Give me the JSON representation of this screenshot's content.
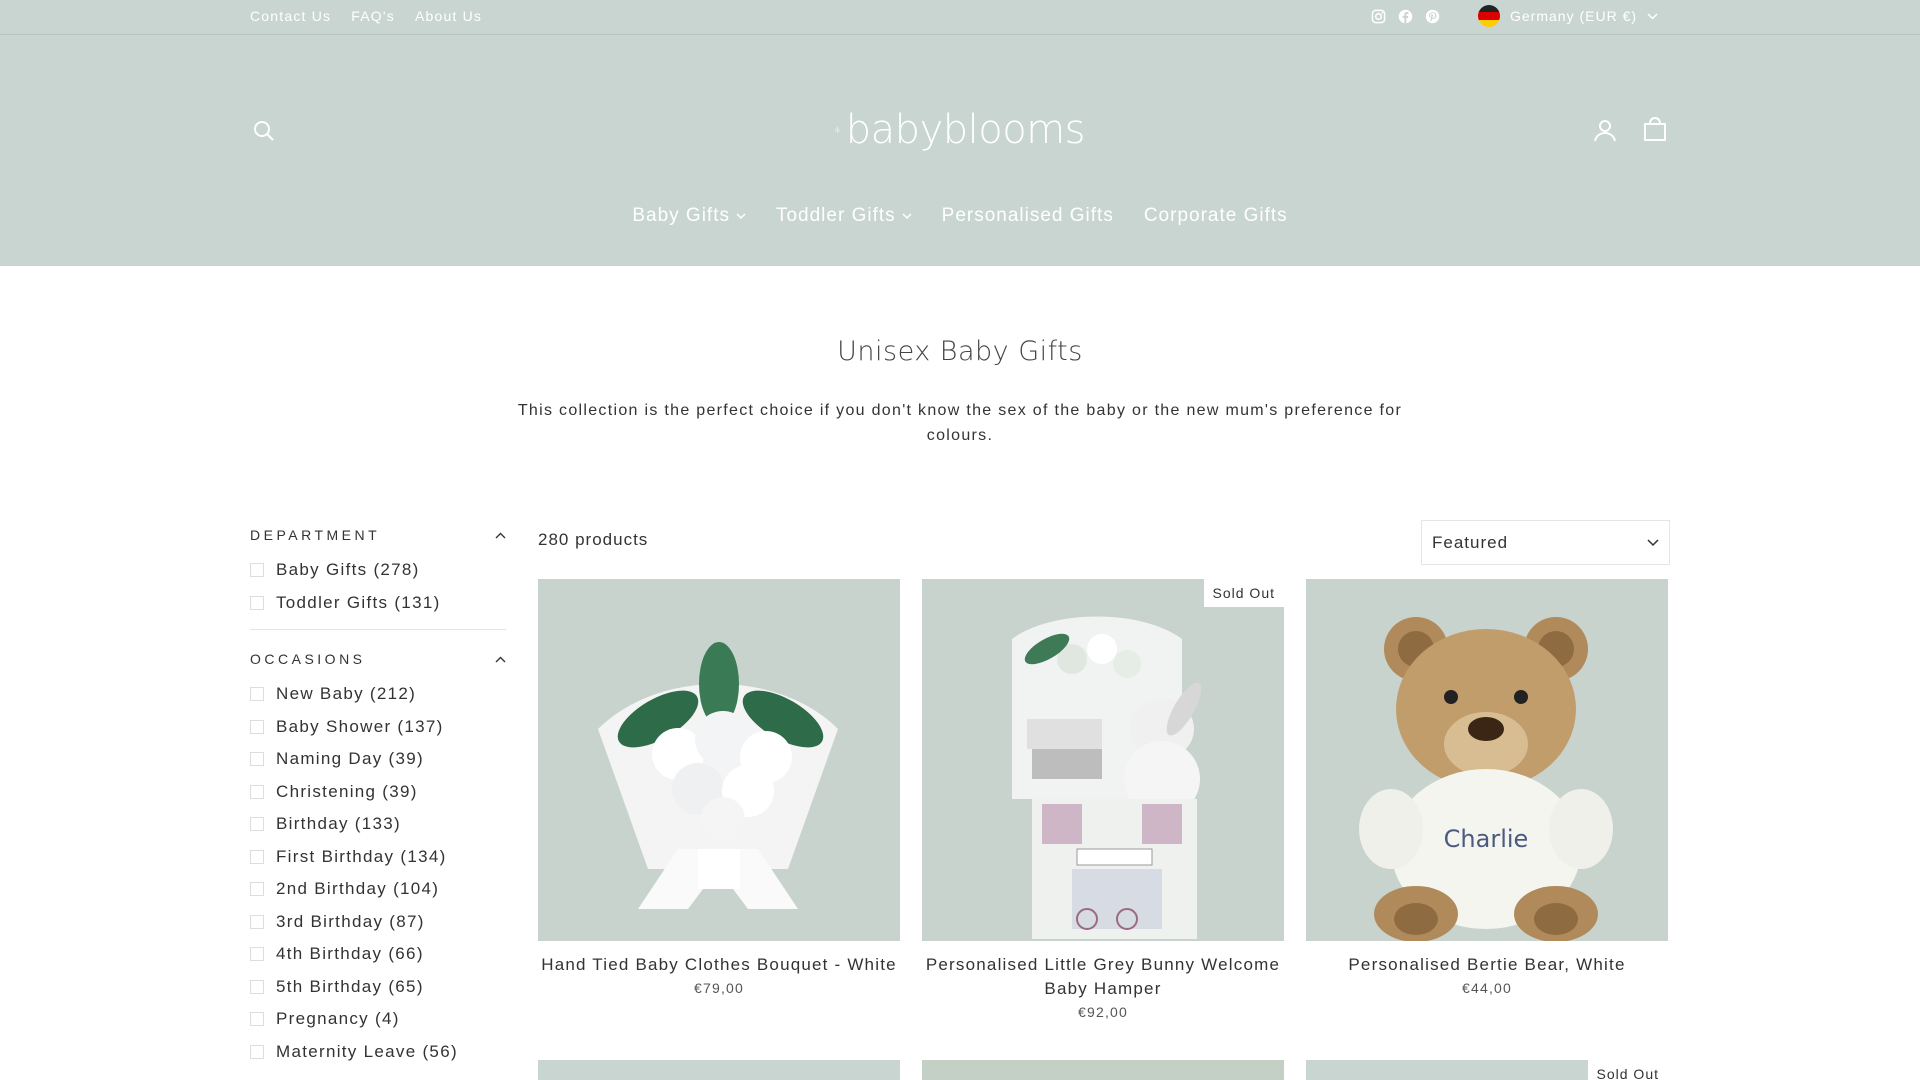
{
  "topbar": {
    "links": [
      "Contact Us",
      "FAQ's",
      "About Us"
    ],
    "social_icons": [
      "instagram-icon",
      "facebook-icon",
      "pinterest-icon"
    ],
    "country": "Germany (EUR €)"
  },
  "header": {
    "logo_text": "babyblooms",
    "nav": [
      {
        "label": "Baby Gifts",
        "has_dropdown": true
      },
      {
        "label": "Toddler Gifts",
        "has_dropdown": true
      },
      {
        "label": "Personalised Gifts",
        "has_dropdown": false
      },
      {
        "label": "Corporate Gifts",
        "has_dropdown": false
      }
    ]
  },
  "collection": {
    "title": "Unisex Baby Gifts",
    "description": "This collection is the perfect choice if you don't know the sex of the baby or the new mum's preference for colours."
  },
  "filters": {
    "department": {
      "heading": "DEPARTMENT",
      "items": [
        "Baby Gifts (278)",
        "Toddler Gifts (131)"
      ]
    },
    "occasions": {
      "heading": "OCCASIONS",
      "items": [
        "New Baby (212)",
        "Baby Shower (137)",
        "Naming Day (39)",
        "Christening (39)",
        "Birthday (133)",
        "First Birthday (134)",
        "2nd Birthday (104)",
        "3rd Birthday (87)",
        "4th Birthday (66)",
        "5th Birthday (65)",
        "Pregnancy (4)",
        "Maternity Leave (56)"
      ]
    }
  },
  "toolbar": {
    "count": "280 products",
    "sort_value": "Featured"
  },
  "products": [
    {
      "name": "Hand Tied Baby Clothes Bouquet - White",
      "price": "€79,00",
      "badge": ""
    },
    {
      "name": "Personalised Little Grey Bunny Welcome Baby Hamper",
      "price": "€92,00",
      "badge": "Sold Out"
    },
    {
      "name": "Personalised Bertie Bear, White",
      "price": "€44,00",
      "badge": "",
      "bear_sweater_text": "Charlie"
    }
  ],
  "row2": {
    "badge": "Sold Out"
  },
  "colors": {
    "header_bg": "#c9d5d0",
    "product_bg": "#c8d3cd",
    "text": "#333333"
  }
}
